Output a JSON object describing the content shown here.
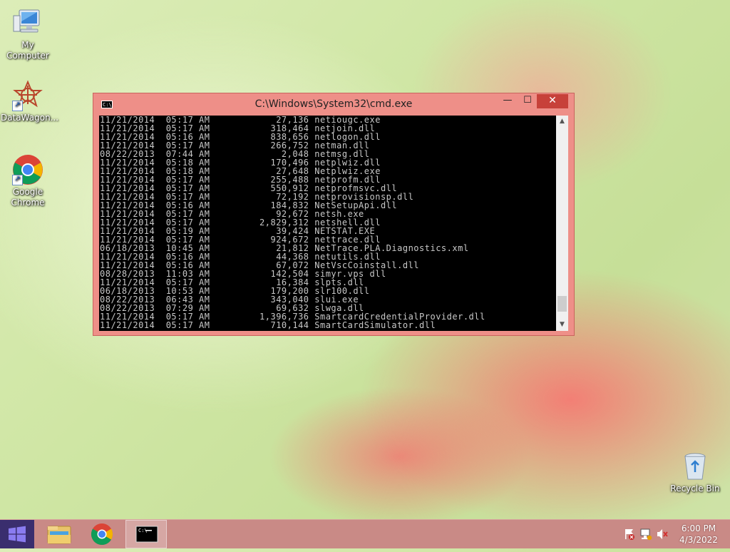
{
  "desktop": {
    "icons": [
      {
        "label": "My Computer",
        "icon": "my-computer-icon"
      },
      {
        "label": "DataWagon...",
        "icon": "datawagon-icon"
      },
      {
        "label": "Google Chrome",
        "icon": "chrome-icon"
      },
      {
        "label": "Recycle Bin",
        "icon": "recycle-bin-icon"
      }
    ]
  },
  "cmd": {
    "title": "C:\\Windows\\System32\\cmd.exe",
    "icon_text": "C:\\",
    "buttons": {
      "minimize": "—",
      "maximize": "☐",
      "close": "✕"
    },
    "lines": [
      "11/21/2014  05:17 AM            27,136 netiougc.exe",
      "11/21/2014  05:17 AM           318,464 netjoin.dll",
      "11/21/2014  05:16 AM           838,656 netlogon.dll",
      "11/21/2014  05:17 AM           266,752 netman.dll",
      "08/22/2013  07:44 AM             2,048 netmsg.dll",
      "11/21/2014  05:18 AM           170,496 netplwiz.dll",
      "11/21/2014  05:18 AM            27,648 Netplwiz.exe",
      "11/21/2014  05:17 AM           255,488 netprofm.dll",
      "11/21/2014  05:17 AM           550,912 netprofmsvc.dll",
      "11/21/2014  05:17 AM            72,192 netprovisionsp.dll",
      "11/21/2014  05:16 AM           184,832 NetSetupApi.dll",
      "11/21/2014  05:17 AM            92,672 netsh.exe",
      "11/21/2014  05:17 AM         2,829,312 netshell.dll",
      "11/21/2014  05:19 AM            39,424 NETSTAT.EXE",
      "11/21/2014  05:17 AM           924,672 nettrace.dll",
      "06/18/2013  10:45 AM            21,812 NetTrace.PLA.Diagnostics.xml",
      "11/21/2014  05:16 AM            44,368 netutils.dll",
      "11/21/2014  05:16 AM            67,072 NetVscCoinstall.dll",
      "08/28/2013  11:03 AM           142,504 simyr.vps dll",
      "11/21/2014  05:17 AM            16,384 slpts.dll",
      "06/18/2013  10:53 AM           179,200 slr100.dll",
      "08/22/2013  06:43 AM           343,040 slui.exe",
      "08/22/2013  07:29 AM            69,632 slwga.dll",
      "11/21/2014  05:17 AM         1,396,736 SmartcardCredentialProvider.dll",
      "11/21/2014  05:17 AM           710,144 SmartCardSimulator.dll"
    ],
    "scroll_position": 0.96
  },
  "taskbar": {
    "pinned": [
      {
        "name": "file-explorer",
        "icon": "folder-icon"
      },
      {
        "name": "chrome",
        "icon": "chrome-icon"
      },
      {
        "name": "cmd",
        "icon": "cmd-icon",
        "active": true
      }
    ],
    "tray_icons": [
      "action-center-flag-icon",
      "network-icon",
      "volume-muted-icon"
    ],
    "clock": {
      "time": "6:00 PM",
      "date": "4/3/2022"
    }
  }
}
